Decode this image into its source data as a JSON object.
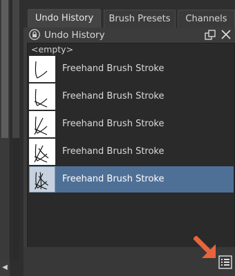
{
  "tabs": [
    "Undo History",
    "Brush Presets",
    "Channels"
  ],
  "docker": {
    "title": "Undo History",
    "empty_label": "<empty>",
    "items": [
      {
        "label": "Freehand Brush Stroke"
      },
      {
        "label": "Freehand Brush Stroke"
      },
      {
        "label": "Freehand Brush Stroke"
      },
      {
        "label": "Freehand Brush Stroke"
      },
      {
        "label": "Freehand Brush Stroke"
      }
    ],
    "selected_index": 4
  },
  "icons": {
    "lock": "lock-icon",
    "float": "float-icon",
    "close": "close-icon",
    "config": "list-settings-icon",
    "scroll_left": "triangle-left-icon",
    "annotation": "arrow-icon"
  },
  "colors": {
    "selected_row": "#4f7096",
    "arrow": "#e8643c"
  }
}
